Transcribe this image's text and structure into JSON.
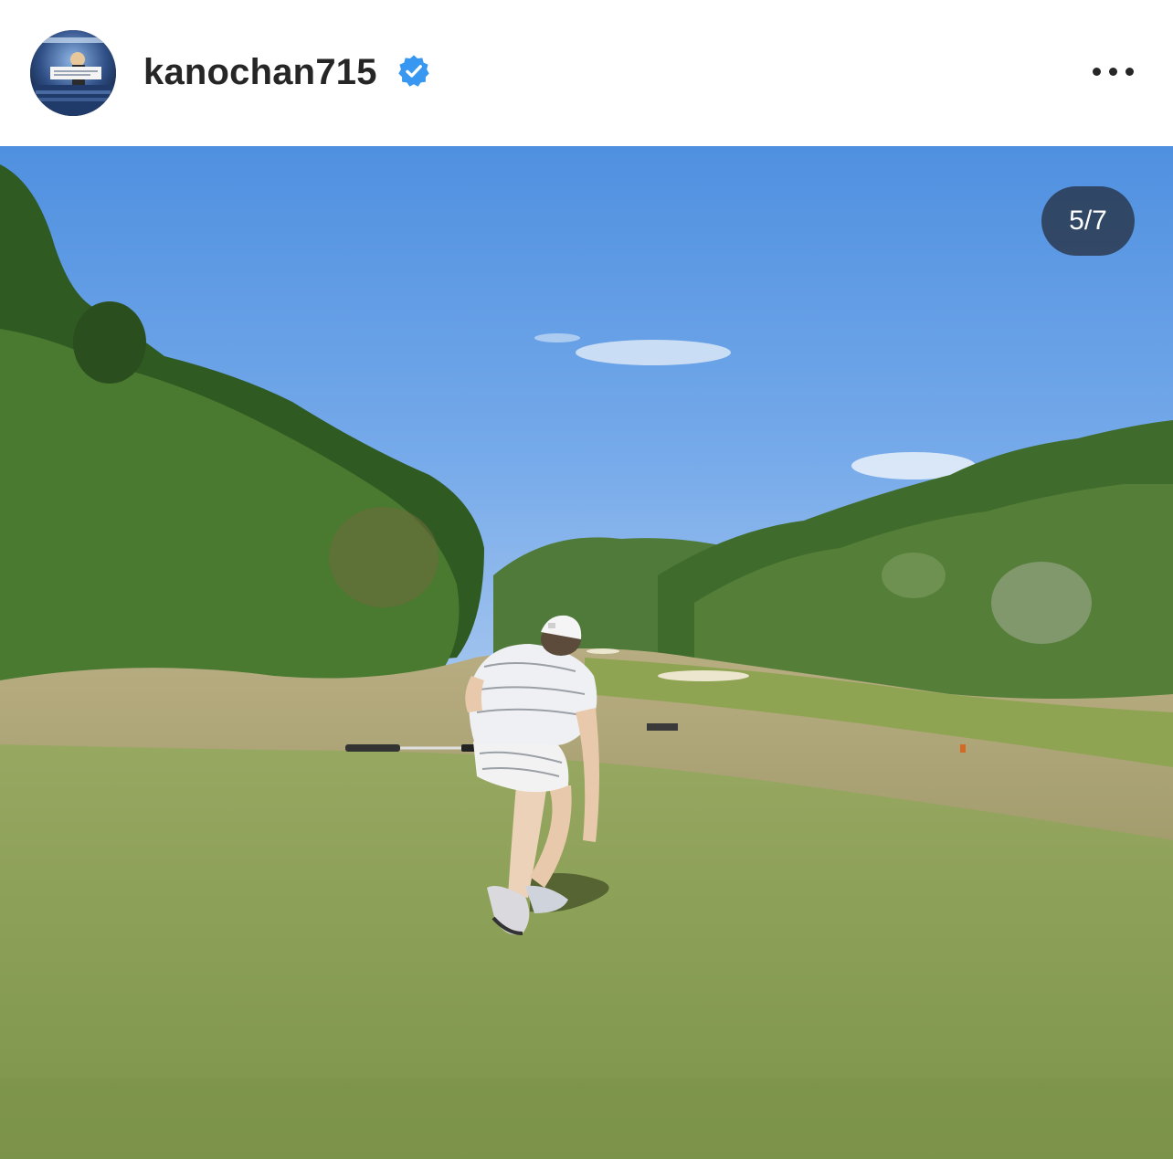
{
  "post": {
    "username": "kanochan715",
    "verified": true,
    "verified_icon": "verified-badge-icon",
    "more_icon": "more-options-icon",
    "carousel": {
      "counter": "5/7"
    },
    "media": {
      "type": "photo"
    }
  },
  "colors": {
    "verified_blue": "#3897f0",
    "username_text": "#262626",
    "counter_bg": "#263142"
  }
}
